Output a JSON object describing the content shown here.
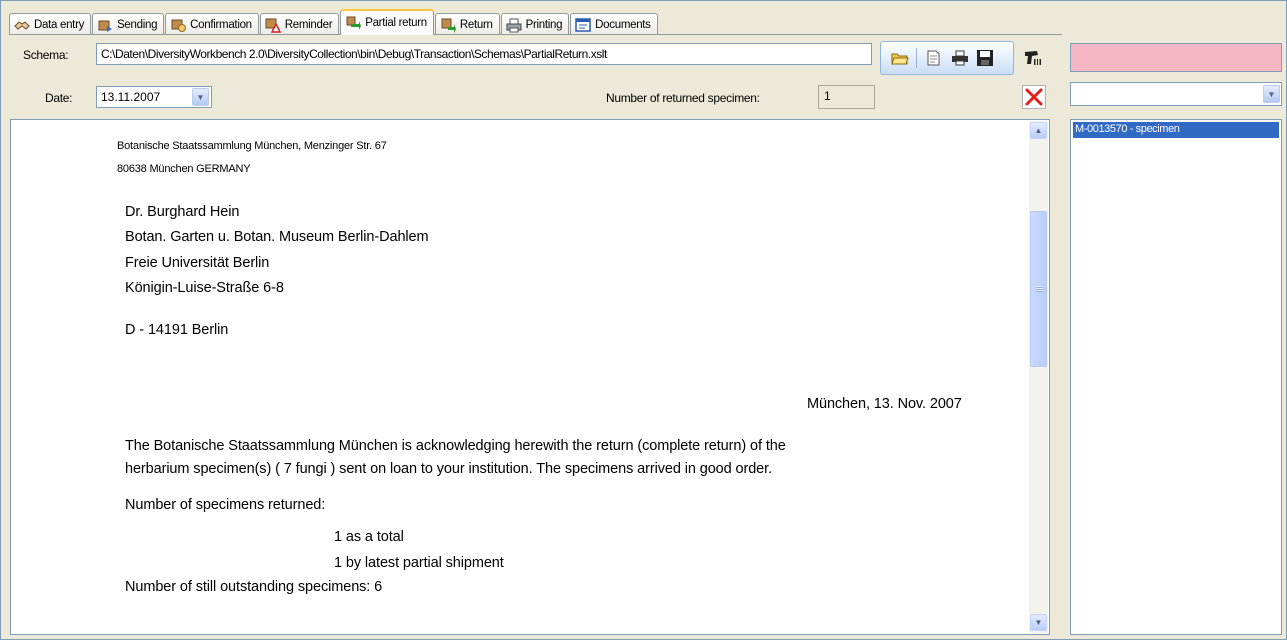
{
  "tabs": [
    {
      "label": "Data entry",
      "icon": "handshake-icon",
      "active": false
    },
    {
      "label": "Sending",
      "icon": "send-package-icon",
      "active": false
    },
    {
      "label": "Confirmation",
      "icon": "confirmation-hand-icon",
      "active": false
    },
    {
      "label": "Reminder",
      "icon": "reminder-warning-icon",
      "active": false
    },
    {
      "label": "Partial return",
      "icon": "partial-return-icon",
      "active": true
    },
    {
      "label": "Return",
      "icon": "return-icon",
      "active": false
    },
    {
      "label": "Printing",
      "icon": "printer-icon",
      "active": false
    },
    {
      "label": "Documents",
      "icon": "documents-icon",
      "active": false
    }
  ],
  "schema": {
    "label": "Schema:",
    "path": "C:\\Daten\\DiversityWorkbench 2.0\\DiversityCollection\\bin\\Debug\\Transaction\\Schemas\\PartialReturn.xslt"
  },
  "date": {
    "label": "Date:",
    "value": "13.11.2007"
  },
  "returned": {
    "label": "Number of returned specimen:",
    "value": "1"
  },
  "toolbar": {
    "icons": [
      "open-folder-icon",
      "document-icon",
      "print-icon",
      "save-icon",
      "barcode-scanner-icon",
      "delete-icon"
    ]
  },
  "colors": {
    "pink_field": "#F5B7C3",
    "selection": "#316AC5",
    "active_tab_accent": "#FFC83C"
  },
  "right_list": {
    "items": [
      "M-0013570 - specimen"
    ],
    "selected_index": 0
  },
  "letter": {
    "sender_line1": "Botanische Staatssammlung München, Menzinger Str. 67",
    "sender_line2": "80638 München GERMANY",
    "recipient": [
      "Dr. Burghard Hein",
      "Botan. Garten u. Botan. Museum Berlin-Dahlem",
      "Freie Universität Berlin",
      "Königin-Luise-Straße 6-8"
    ],
    "recipient_city": "D - 14191 Berlin",
    "place_date": "München, 13. Nov. 2007",
    "body_line1": "The Botanische Staatssammlung München is acknowledging herewith the return (complete return) of the",
    "body_line2": "herbarium specimen(s) ( 7 fungi ) sent on loan to your institution. The specimens arrived in good order.",
    "returned_heading": "Number of specimens returned:",
    "returned_total": "1 as a total",
    "returned_partial": "1 by latest partial shipment",
    "outstanding": "Number of still outstanding specimens: 6"
  }
}
